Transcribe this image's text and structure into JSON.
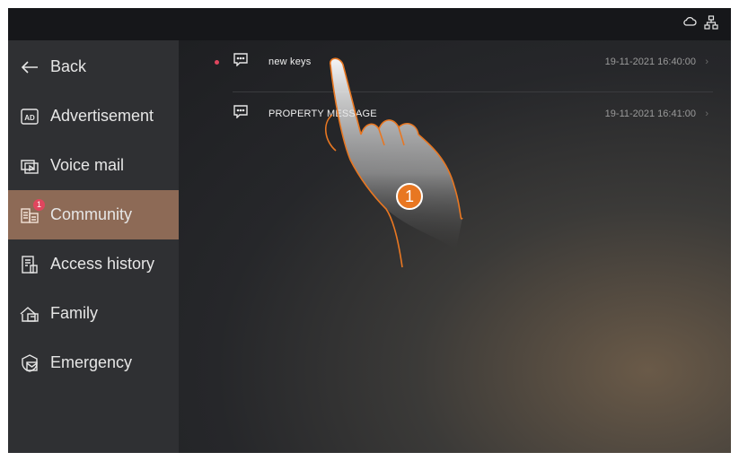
{
  "topbar": {
    "icons": [
      "cloud-icon",
      "network-icon"
    ]
  },
  "sidebar": {
    "items": [
      {
        "label": "Back",
        "icon": "back-arrow-icon"
      },
      {
        "label": "Advertisement",
        "icon": "ad-icon"
      },
      {
        "label": "Voice mail",
        "icon": "voice-mail-icon"
      },
      {
        "label": "Community",
        "icon": "community-icon",
        "active": true,
        "badge": "1"
      },
      {
        "label": "Access history",
        "icon": "access-history-icon"
      },
      {
        "label": "Family",
        "icon": "family-icon"
      },
      {
        "label": "Emergency",
        "icon": "emergency-icon"
      }
    ]
  },
  "messages": [
    {
      "title": "new keys",
      "time": "19-11-2021 16:40:00",
      "unread": true
    },
    {
      "title": "PROPERTY MESSAGE",
      "time": "19-11-2021 16:41:00",
      "unread": false
    }
  ],
  "callout": {
    "number": "1"
  },
  "colors": {
    "active_bg": "#8d6a56",
    "unread_dot": "#e0465e",
    "callout": "#e87722"
  }
}
